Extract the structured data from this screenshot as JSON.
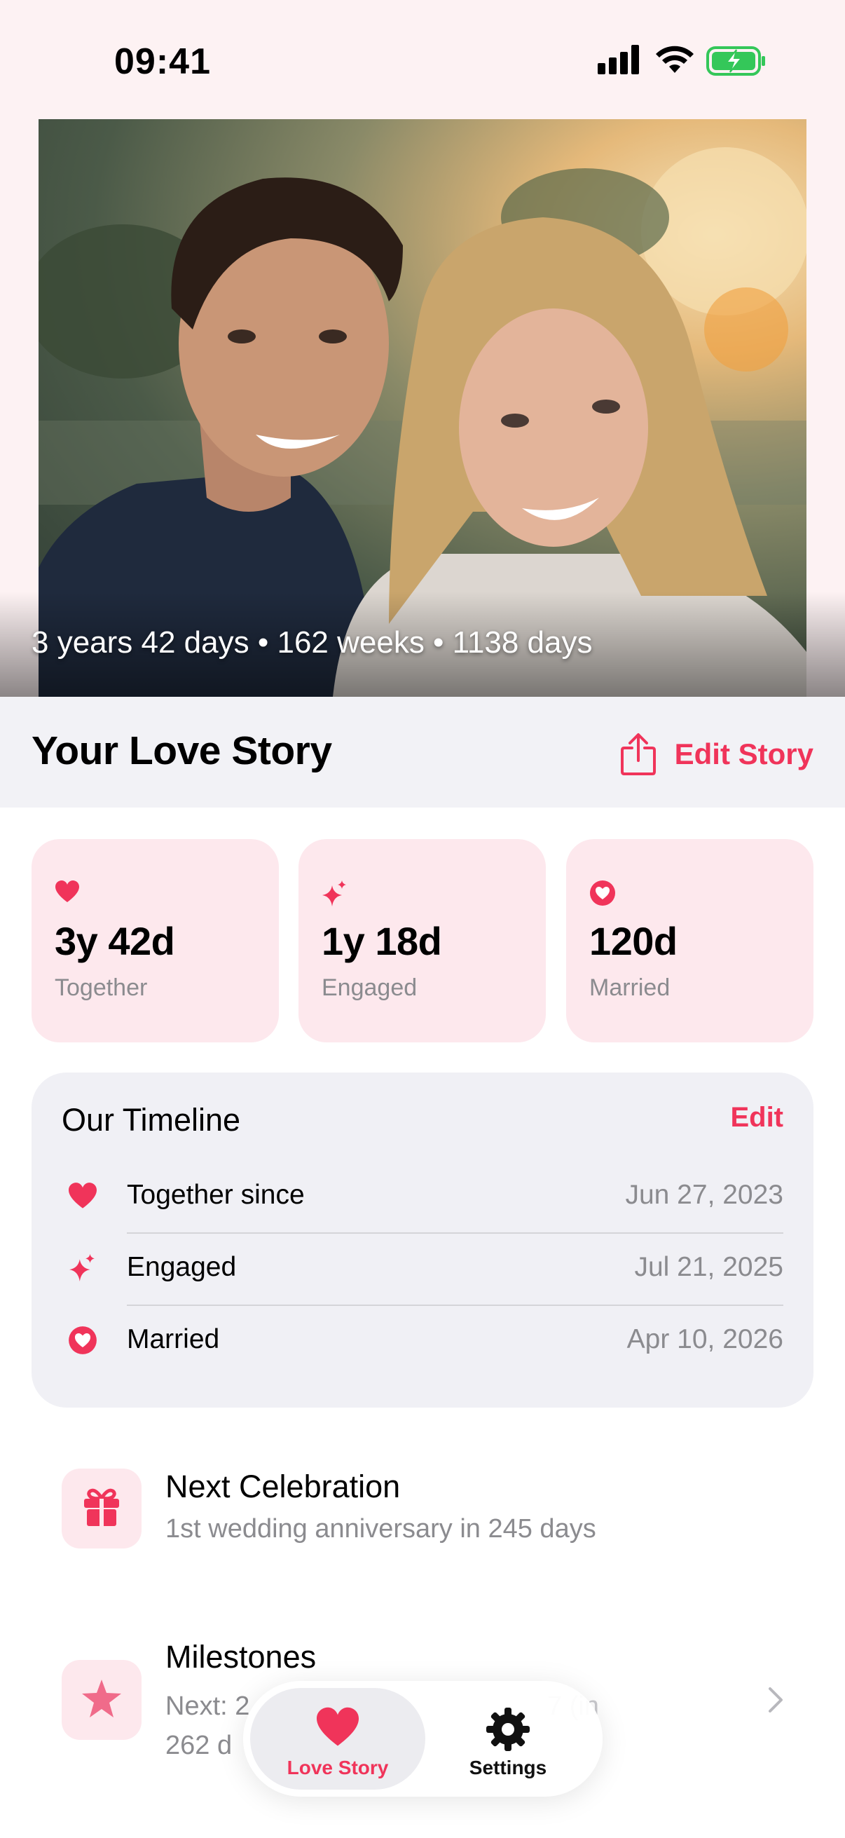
{
  "status_bar": {
    "time": "09:41",
    "icons": [
      "cellular-signal-icon",
      "wifi-icon",
      "battery-charging-icon"
    ]
  },
  "hero": {
    "caption": "3 years 42 days • 162 weeks • 1138 days"
  },
  "header": {
    "title": "Your Love Story",
    "edit_label": "Edit Story",
    "edit_icon": "share-icon"
  },
  "stats": [
    {
      "icon": "heart-icon",
      "value": "3y 42d",
      "label": "Together"
    },
    {
      "icon": "sparkles-icon",
      "value": "1y 18d",
      "label": "Engaged"
    },
    {
      "icon": "heart-circle-icon",
      "value": "120d",
      "label": "Married"
    }
  ],
  "timeline": {
    "title": "Our Timeline",
    "edit_label": "Edit",
    "rows": [
      {
        "icon": "heart-icon",
        "label": "Together since",
        "date": "Jun 27, 2023"
      },
      {
        "icon": "sparkles-icon",
        "label": "Engaged",
        "date": "Jul 21, 2025"
      },
      {
        "icon": "heart-circle-icon",
        "label": "Married",
        "date": "Apr 10, 2026"
      }
    ]
  },
  "next_celebration": {
    "icon": "gift-icon",
    "title": "Next Celebration",
    "subtitle": "1st wedding anniversary in 245 days"
  },
  "milestones": {
    "icon": "star-icon",
    "title": "Milestones",
    "subtitle_line1": "Next: 2",
    "subtitle_line1_end": "7 (in",
    "subtitle_line2": "262 d"
  },
  "tabbar": {
    "tabs": [
      {
        "icon": "heart-icon",
        "label": "Love Story",
        "active": true
      },
      {
        "icon": "gear-icon",
        "label": "Settings",
        "active": false
      }
    ]
  },
  "colors": {
    "accent": "#f0345a",
    "card_bg": "#fde8ed",
    "panel_bg": "#f0f0f5",
    "secondary_text": "#8b8b8f",
    "hero_bg": "#fdf2f3"
  }
}
